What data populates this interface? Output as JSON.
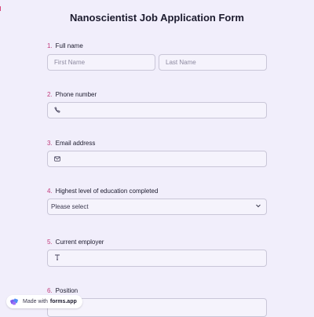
{
  "form": {
    "title": "Nanoscientist Job Application Form",
    "questions": [
      {
        "number": "1.",
        "label": "Full name",
        "placeholders": [
          "First Name",
          "Last Name"
        ]
      },
      {
        "number": "2.",
        "label": "Phone number",
        "icon": "phone-icon"
      },
      {
        "number": "3.",
        "label": "Email address",
        "icon": "mail-icon"
      },
      {
        "number": "4.",
        "label": "Highest level of education completed",
        "select_value": "Please select"
      },
      {
        "number": "5.",
        "label": "Current employer",
        "icon": "text-icon"
      },
      {
        "number": "6.",
        "label": "Position"
      }
    ]
  },
  "badge": {
    "prefix": "Made with",
    "brand": "forms.app"
  },
  "colors": {
    "background": "#f1eefb",
    "accent": "#c2397a",
    "border": "#c9c6d8"
  }
}
